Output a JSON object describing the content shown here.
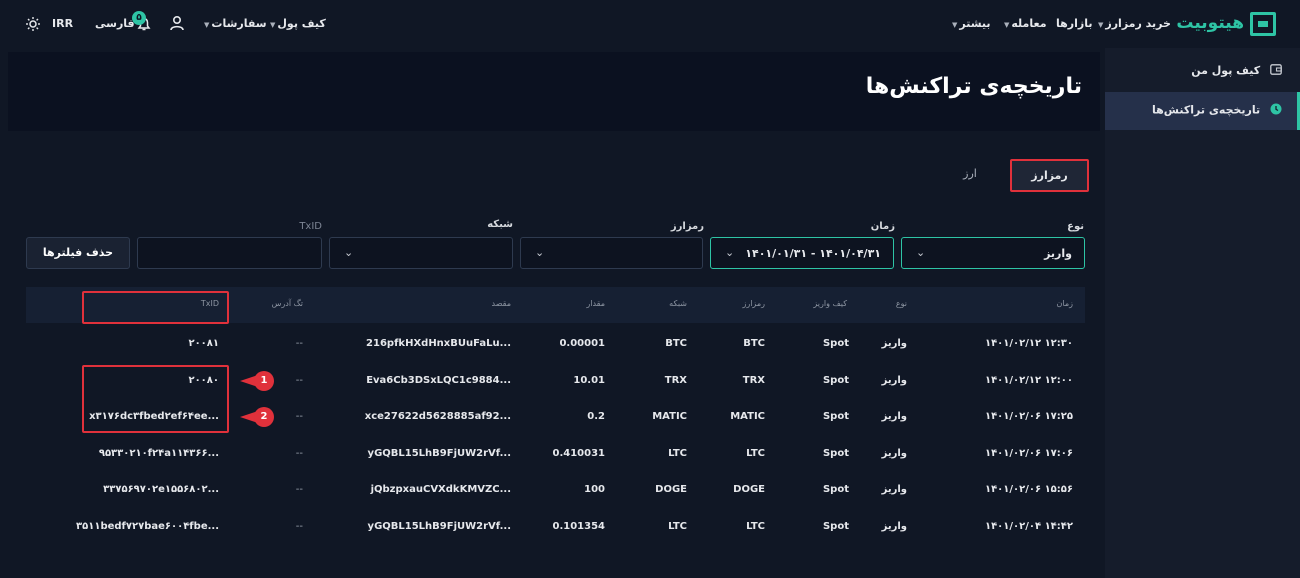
{
  "nav": {
    "buy_crypto": "خرید رمزارز",
    "markets": "بازارها",
    "trade": "معامله",
    "more": "بیشتر",
    "wallet": "کیف پول",
    "orders": "سفارشات",
    "language": "فارسی",
    "notifications_count": "۵",
    "currency": "IRR",
    "logo_text": "هیتوبیت"
  },
  "sidebar": {
    "items": [
      {
        "label": "کیف پول من",
        "icon": "wallet-icon"
      },
      {
        "label": "تاریخچه‌ی تراکنش‌ها",
        "icon": "clock-icon",
        "active": true
      }
    ]
  },
  "page": {
    "title": "تاریخچه‌ی تراکنش‌ها"
  },
  "tabs": [
    {
      "label": "رمزارز",
      "active": true
    },
    {
      "label": "ارز",
      "active": false
    }
  ],
  "filters": {
    "type": {
      "label": "نوع",
      "value": "واریز"
    },
    "time": {
      "label": "زمان",
      "value": "۱۴۰۱/۰۱/۳۱ - ۱۴۰۱/۰۴/۳۱"
    },
    "crypto": {
      "label": "رمزارز",
      "value": ""
    },
    "network": {
      "label": "شبکه",
      "value": ""
    },
    "txid": {
      "label": "TxID",
      "value": ""
    },
    "clear_button": "حذف فیلترها"
  },
  "table": {
    "headers": {
      "time": "زمان",
      "type": "نوع",
      "wallet": "کیف واریز",
      "crypto": "رمزارز",
      "network": "شبکه",
      "amount": "مقدار",
      "destination": "مقصد",
      "address_tag": "تگ آدرس",
      "txid": "TxID"
    },
    "rows": [
      {
        "time": "۱۴۰۱/۰۲/۱۲ ۱۲:۳۰",
        "type": "واریز",
        "wallet": "Spot",
        "crypto": "BTC",
        "network": "BTC",
        "amount": "0.00001",
        "destination": "216pfkHXdHnxBUuFaLu...",
        "tag": "--",
        "txid": "۲۰۰۸۱"
      },
      {
        "time": "۱۴۰۱/۰۲/۱۲ ۱۲:۰۰",
        "type": "واریز",
        "wallet": "Spot",
        "crypto": "TRX",
        "network": "TRX",
        "amount": "10.01",
        "destination": "Eva6Cb3DSxLQC1c9884...",
        "tag": "--",
        "txid": "۲۰۰۸۰"
      },
      {
        "time": "۱۴۰۱/۰۲/۰۶ ۱۷:۲۵",
        "type": "واریز",
        "wallet": "Spot",
        "crypto": "MATIC",
        "network": "MATIC",
        "amount": "0.2",
        "destination": "xce27622d5628885af92...",
        "tag": "--",
        "txid": "x۳۱۷۶dc۳fbed۲ef۶۴ee..."
      },
      {
        "time": "۱۴۰۱/۰۲/۰۶ ۱۷:۰۶",
        "type": "واریز",
        "wallet": "Spot",
        "crypto": "LTC",
        "network": "LTC",
        "amount": "0.410031",
        "destination": "yGQBL15LhB9FjUW2rVf...",
        "tag": "--",
        "txid": "۹۵۳۳۰۲۱۰f۲۴a۱۱۴۳۶۶..."
      },
      {
        "time": "۱۴۰۱/۰۲/۰۶ ۱۵:۵۶",
        "type": "واریز",
        "wallet": "Spot",
        "crypto": "DOGE",
        "network": "DOGE",
        "amount": "100",
        "destination": "jQbzpxauCVXdkKMVZC...",
        "tag": "--",
        "txid": "۳۳۷۵۶۹۷۰۲e۱۵۵۶۸۰۲..."
      },
      {
        "time": "۱۴۰۱/۰۲/۰۴ ۱۴:۴۲",
        "type": "واریز",
        "wallet": "Spot",
        "crypto": "LTC",
        "network": "LTC",
        "amount": "0.101354",
        "destination": "yGQBL15LhB9FjUW2rVf...",
        "tag": "--",
        "txid": "۳۵۱۱bedf۷۲۷bae۶۰۰۴fbe..."
      }
    ]
  },
  "annotations": [
    {
      "number": "1"
    },
    {
      "number": "2"
    }
  ],
  "colors": {
    "accent": "#2ec4a5",
    "highlight": "#e0313b",
    "background": "#101725"
  }
}
